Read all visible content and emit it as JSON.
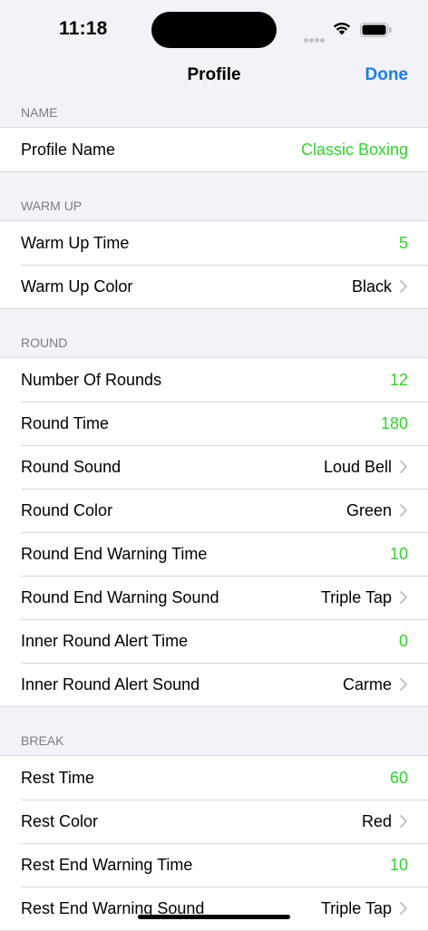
{
  "status_bar": {
    "time": "11:18"
  },
  "nav": {
    "title": "Profile",
    "done_label": "Done"
  },
  "sections": {
    "name": {
      "header": "NAME",
      "rows": [
        {
          "label": "Profile Name",
          "value": "Classic Boxing"
        }
      ]
    },
    "warm_up": {
      "header": "WARM UP",
      "rows": [
        {
          "label": "Warm Up Time",
          "value": "5"
        },
        {
          "label": "Warm Up Color",
          "value": "Black"
        }
      ]
    },
    "round": {
      "header": "ROUND",
      "rows": [
        {
          "label": "Number Of Rounds",
          "value": "12"
        },
        {
          "label": "Round Time",
          "value": "180"
        },
        {
          "label": "Round Sound",
          "value": "Loud Bell"
        },
        {
          "label": "Round Color",
          "value": "Green"
        },
        {
          "label": "Round End Warning Time",
          "value": "10"
        },
        {
          "label": "Round End Warning Sound",
          "value": "Triple Tap"
        },
        {
          "label": "Inner Round Alert Time",
          "value": "0"
        },
        {
          "label": "Inner Round Alert Sound",
          "value": "Carme"
        }
      ]
    },
    "break": {
      "header": "BREAK",
      "rows": [
        {
          "label": "Rest Time",
          "value": "60"
        },
        {
          "label": "Rest Color",
          "value": "Red"
        },
        {
          "label": "Rest End Warning Time",
          "value": "10"
        },
        {
          "label": "Rest End Warning Sound",
          "value": "Triple Tap"
        }
      ]
    }
  },
  "colors": {
    "accent": "#1a7ff5",
    "editable_value": "#2fd52a",
    "background": "#f2f2f7"
  }
}
